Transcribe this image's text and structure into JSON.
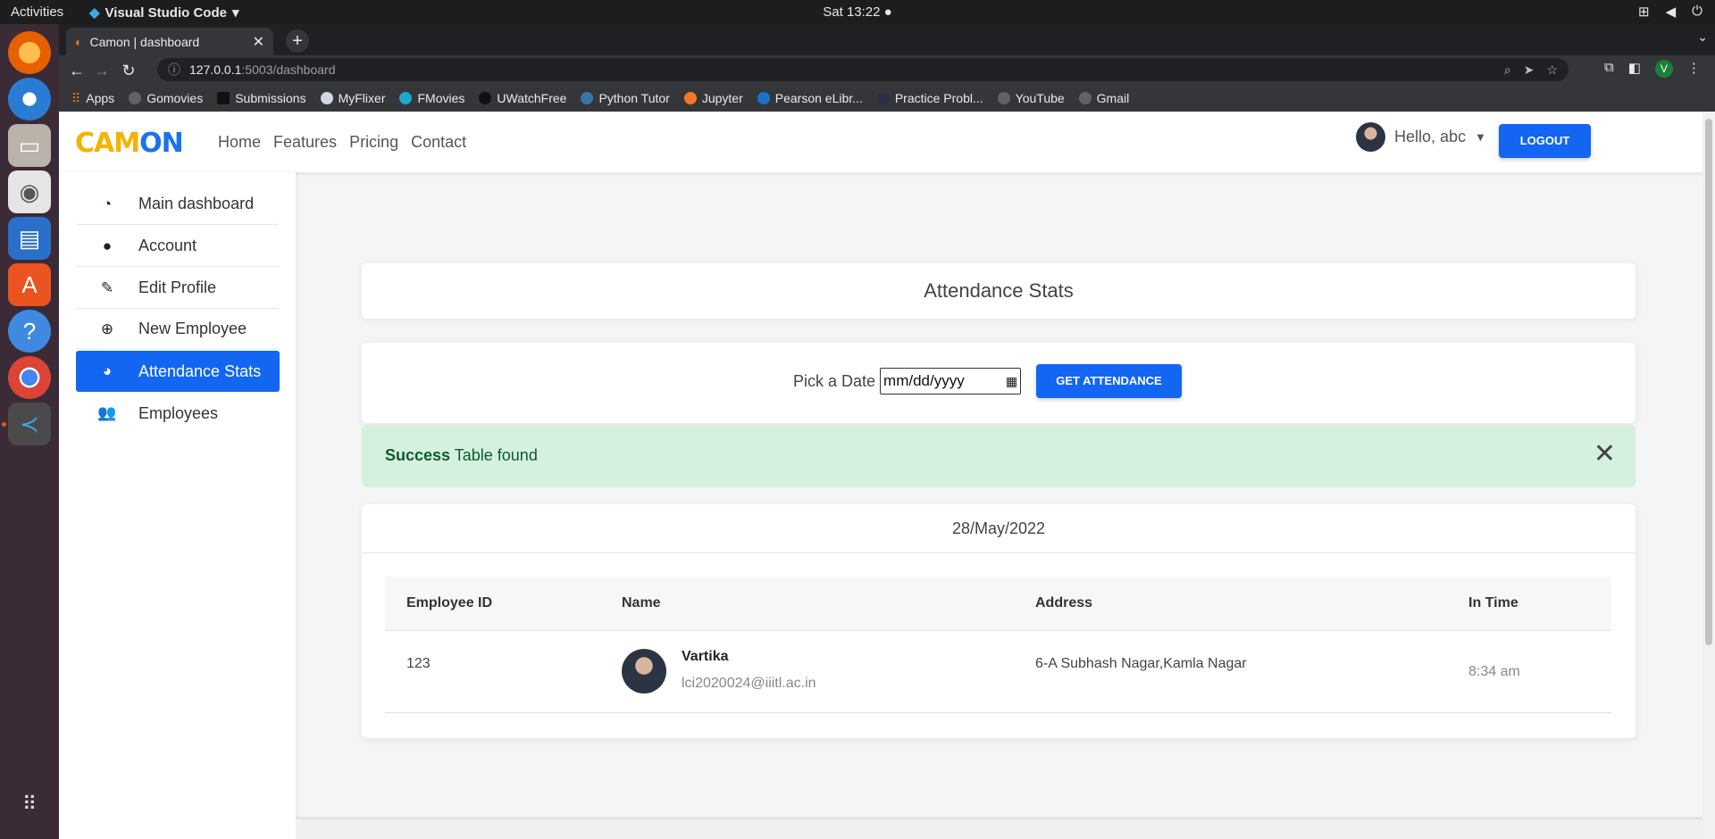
{
  "os": {
    "activities": "Activities",
    "app_name": "Visual Studio Code",
    "clock": "Sat 13:22 ●"
  },
  "browser": {
    "tab_title": "Camon | dashboard",
    "url_host": "127.0.0.1",
    "url_path": ":5003/dashboard",
    "profile_initial": "V",
    "bookmarks": [
      "Apps",
      "Gomovies",
      "Submissions",
      "MyFlixer",
      "FMovies",
      "UWatchFree",
      "Python Tutor",
      "Jupyter",
      "Pearson eLibr...",
      "Practice Probl...",
      "YouTube",
      "Gmail"
    ]
  },
  "site": {
    "logo_part1": "CAM",
    "logo_part2": "ON",
    "nav": [
      "Home",
      "Features",
      "Pricing",
      "Contact"
    ],
    "user_greeting": "Hello, abc",
    "logout_label": "LOGOUT"
  },
  "sidebar": {
    "items": [
      {
        "label": "Main dashboard",
        "icon": "gauge-icon",
        "active": false
      },
      {
        "label": "Account",
        "icon": "user-icon",
        "active": false
      },
      {
        "label": "Edit Profile",
        "icon": "user-edit-icon",
        "active": false
      },
      {
        "label": "New Employee",
        "icon": "plus-circle-icon",
        "active": false
      },
      {
        "label": "Attendance Stats",
        "icon": "pie-chart-icon",
        "active": true
      },
      {
        "label": "Employees",
        "icon": "users-icon",
        "active": false
      }
    ]
  },
  "main": {
    "title": "Attendance Stats",
    "pick_label": "Pick a Date",
    "date_placeholder": "mm/dd/yyyy",
    "get_button": "GET ATTENDANCE",
    "alert_strong": "Success",
    "alert_text": "Table found",
    "table_date": "28/May/2022",
    "columns": [
      "Employee ID",
      "Name",
      "Address",
      "In Time"
    ],
    "rows": [
      {
        "id": "123",
        "name": "Vartika",
        "email": "lci2020024@iiitl.ac.in",
        "address": "6-A Subhash Nagar,Kamla Nagar",
        "in_time": "8:34 am"
      }
    ]
  }
}
